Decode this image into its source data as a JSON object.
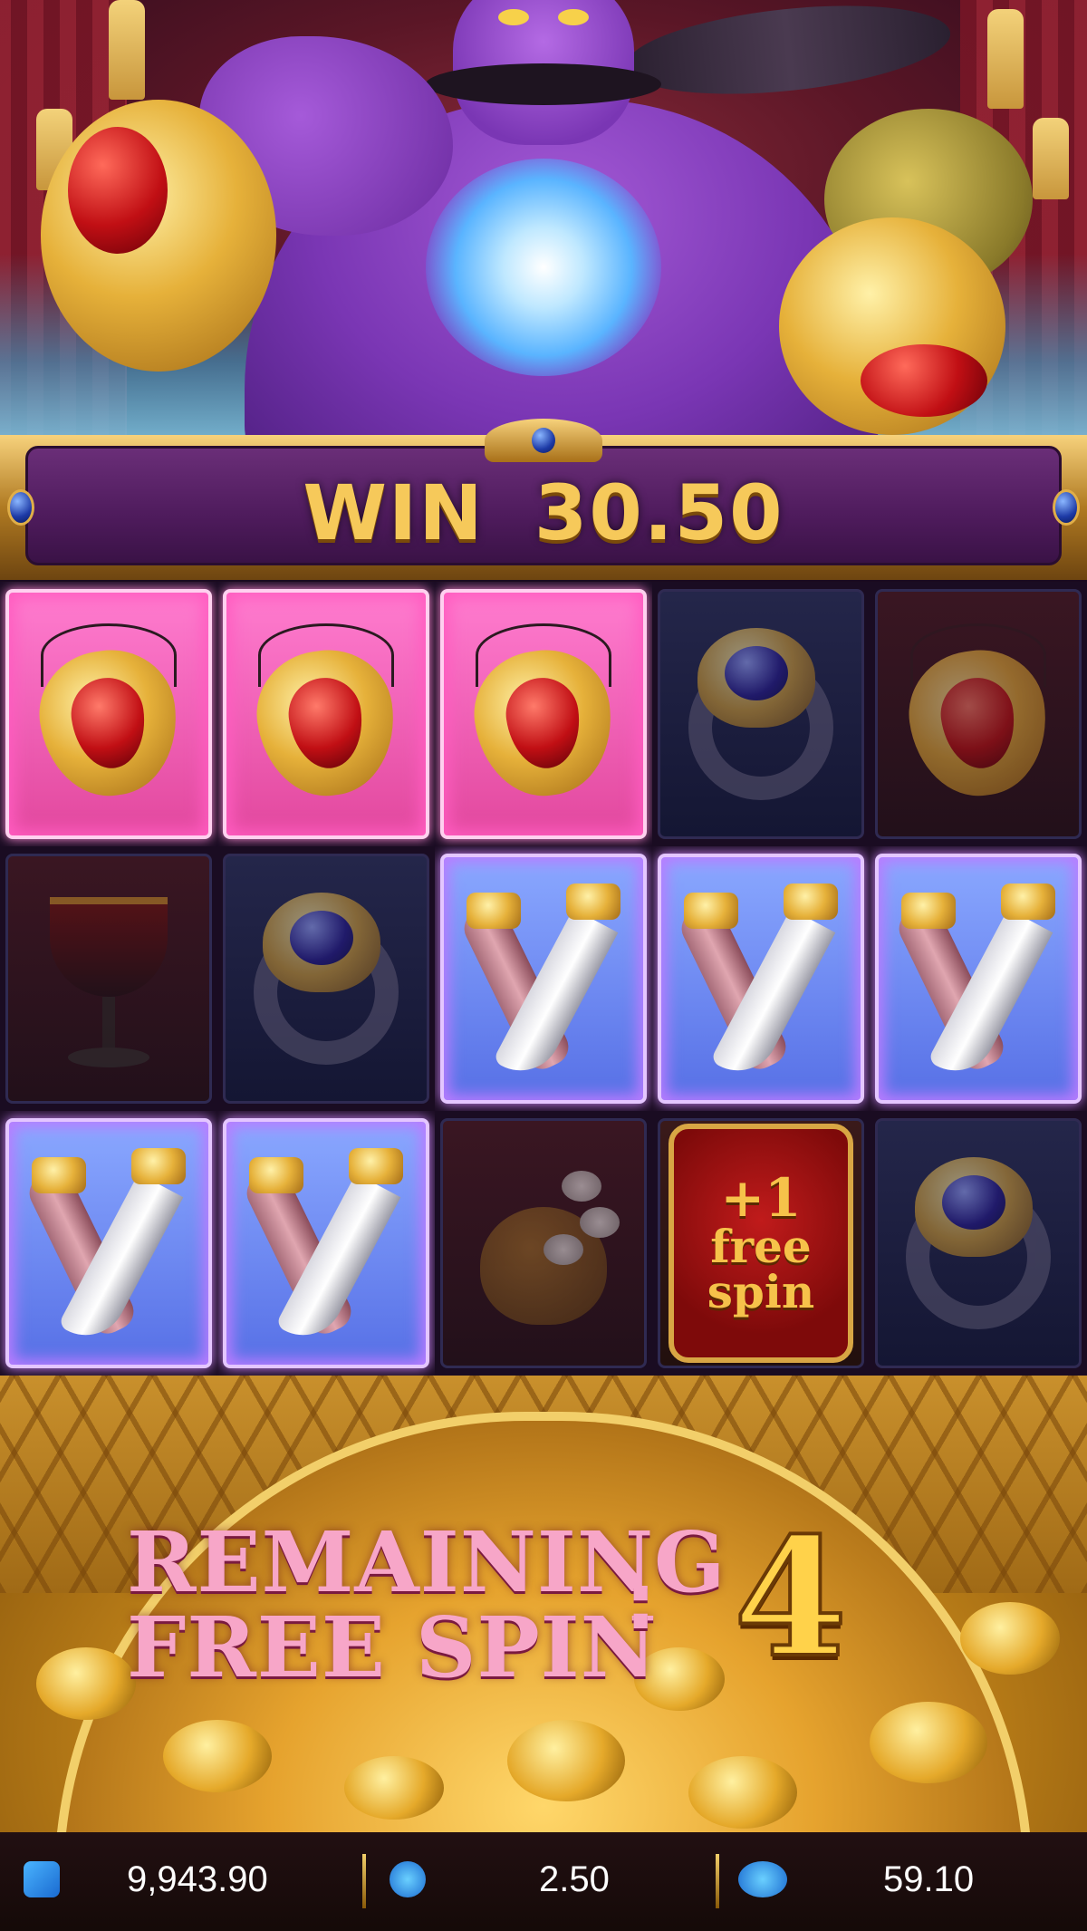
{
  "win_banner": {
    "label": "WIN",
    "amount": "30.50"
  },
  "grid": {
    "rows": [
      [
        "amulet",
        "amulet",
        "amulet",
        "ring",
        "amulet"
      ],
      [
        "goblet",
        "ring",
        "daggers",
        "daggers",
        "daggers"
      ],
      [
        "daggers",
        "daggers",
        "coin-bag",
        "free-spin",
        "ring"
      ]
    ]
  },
  "free_spin_tile": {
    "plus": "+1",
    "line1": "free",
    "line2": "spin"
  },
  "free_spins": {
    "line1": "REMAINING",
    "line2": "FREE SPIN",
    "separator": ":",
    "count": "4"
  },
  "bottom_bar": {
    "balance": "9,943.90",
    "bet": "2.50",
    "win": "59.10"
  },
  "colors": {
    "win_gold": "#f6c95a",
    "banner_purple": "#4e1b5c",
    "remaining_pink": "#f7a6c8",
    "count_gold": "#ffd24a"
  }
}
